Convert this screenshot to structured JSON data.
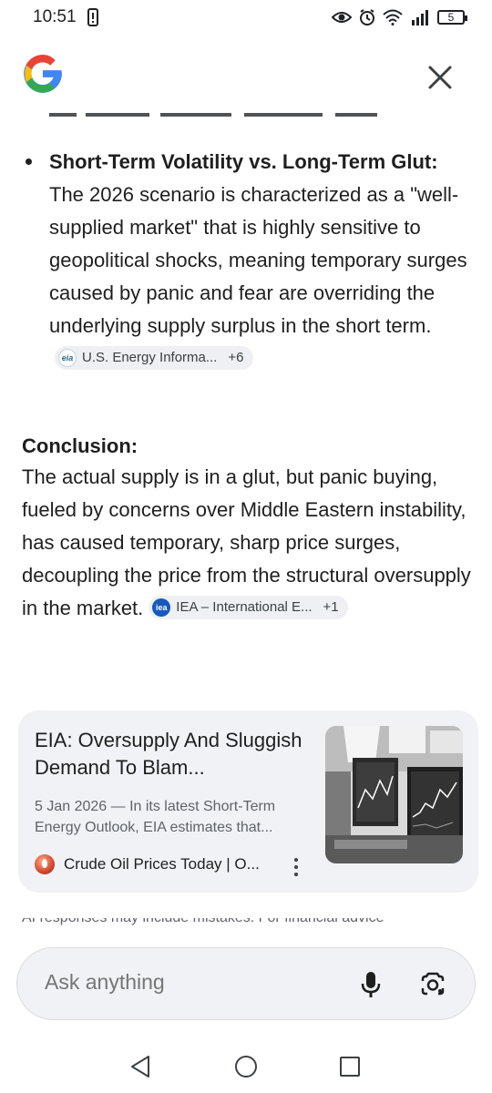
{
  "status_bar": {
    "time": "10:51",
    "battery_level": "5"
  },
  "header": {
    "logo_icon": "google-g-logo",
    "close_icon": "close-icon"
  },
  "bullet": {
    "heading": "Short-Term Volatility vs. Long-Term Glut:",
    "body": " The 2026 scenario is characterized as a \"well-supplied market\" that is highly sensitive to geopolitical shocks, meaning temporary surges caused by panic and fear are overriding the underlying supply surplus in the short term.",
    "citation": {
      "logo_text": "eia",
      "label": "U.S. Energy Informa...",
      "more": "+6"
    }
  },
  "conclusion": {
    "heading": "Conclusion:",
    "body": "The actual supply is in a glut, but panic buying, fueled by concerns over Middle Eastern instability, has caused temporary, sharp price surges, decoupling the price from the structural oversupply in the market.",
    "citation": {
      "logo_text": "iea",
      "label": "IEA – International E...",
      "more": "+1"
    }
  },
  "card": {
    "title": "EIA: Oversupply And Sluggish Demand To Blam...",
    "snippet": "5 Jan 2026 — In its latest Short-Term Energy Outlook, EIA estimates that...",
    "source": "Crude Oil Prices Today | O...",
    "colors": {
      "background": "#f0f2f6"
    }
  },
  "disclaimer": "AI responses may include mistakes. For financial advice",
  "search": {
    "placeholder": "Ask anything"
  },
  "nav": {
    "back_icon": "back-triangle-icon",
    "home_icon": "home-circle-icon",
    "recents_icon": "recents-square-icon"
  }
}
